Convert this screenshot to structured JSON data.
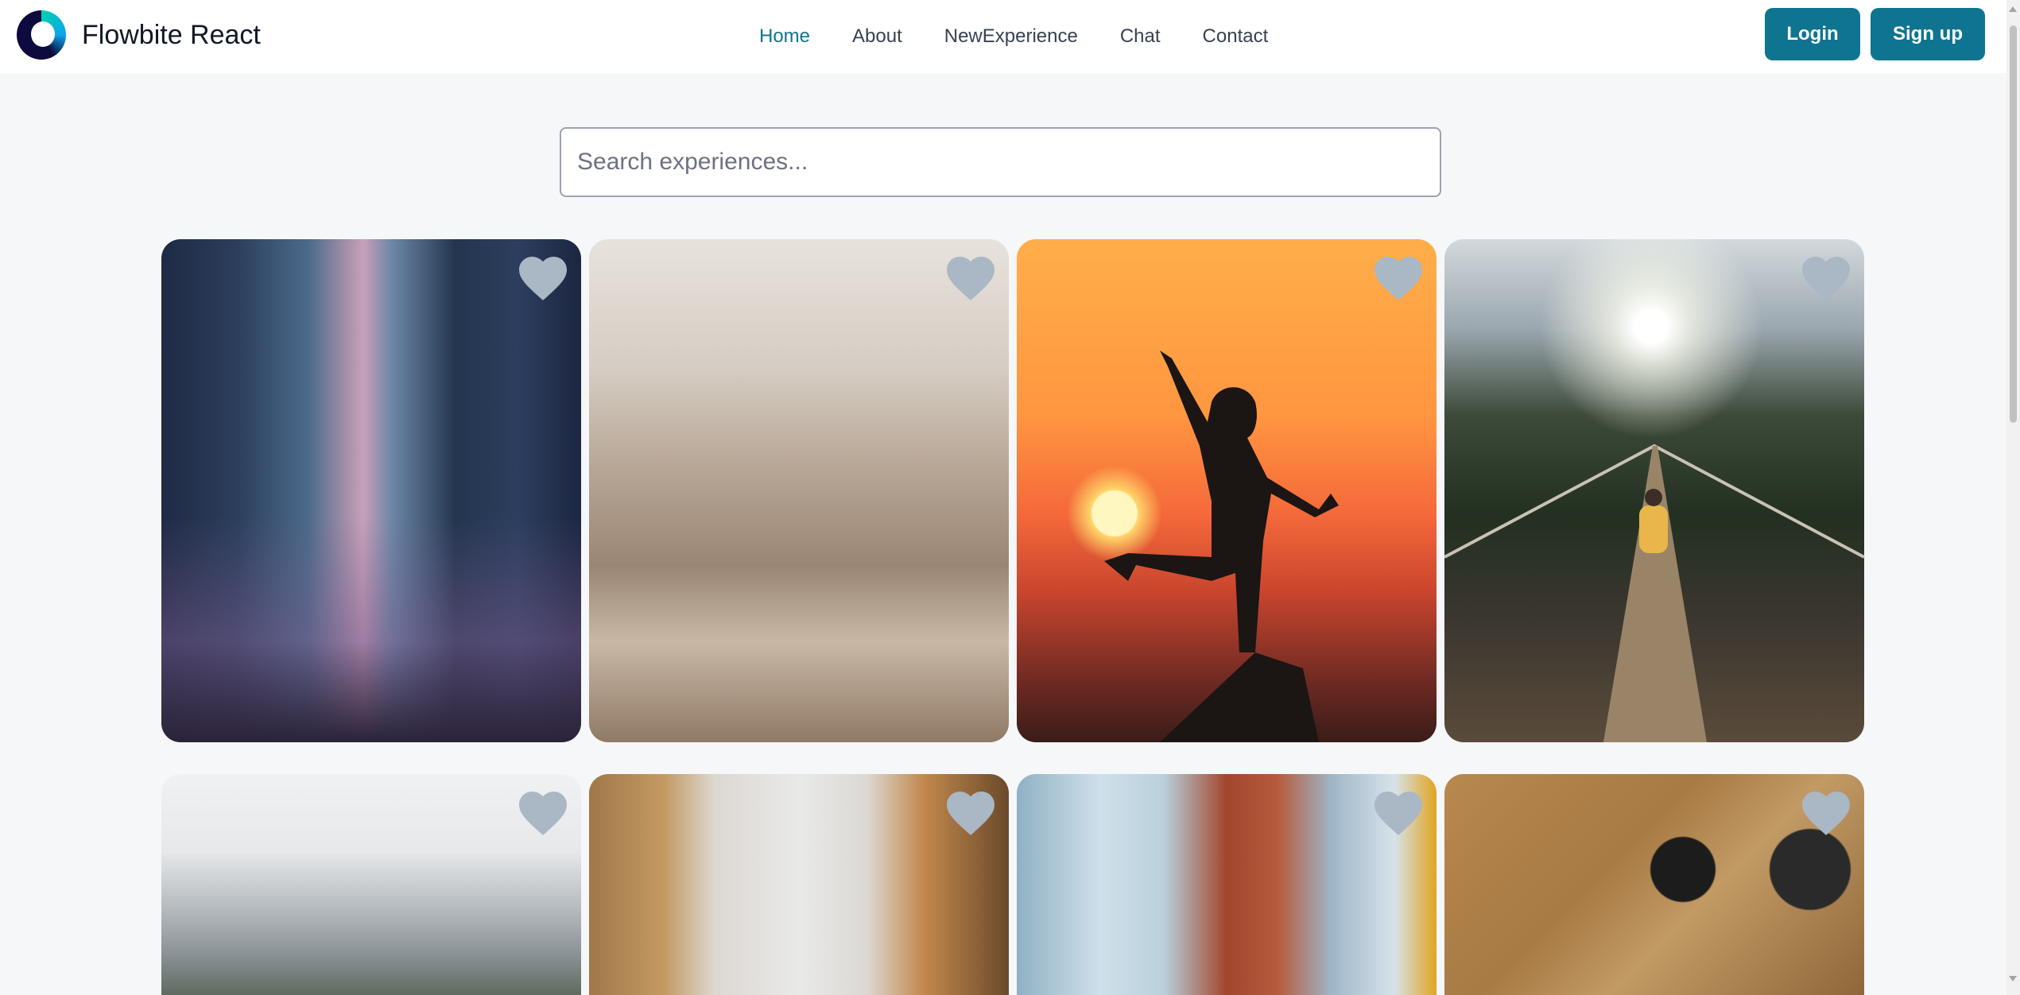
{
  "brand": {
    "name": "Flowbite React"
  },
  "nav": {
    "links": [
      {
        "label": "Home",
        "active": true
      },
      {
        "label": "About"
      },
      {
        "label": "NewExperience"
      },
      {
        "label": "Chat"
      },
      {
        "label": "Contact"
      }
    ]
  },
  "auth": {
    "login_label": "Login",
    "signup_label": "Sign up"
  },
  "search": {
    "placeholder": "Search experiences...",
    "value": ""
  },
  "cards": [
    {
      "image": "city street at dusk",
      "favorite_icon": "heart-icon"
    },
    {
      "image": "city skyline from above",
      "favorite_icon": "heart-icon"
    },
    {
      "image": "silhouette jumping at sunset",
      "favorite_icon": "heart-icon"
    },
    {
      "image": "hiker on suspension bridge",
      "favorite_icon": "heart-icon"
    },
    {
      "image": "rocky mountain range",
      "favorite_icon": "heart-icon"
    },
    {
      "image": "old buildings looking up",
      "favorite_icon": "heart-icon"
    },
    {
      "image": "toronto flatiron building",
      "favorite_icon": "heart-icon"
    },
    {
      "image": "vintage map with camera",
      "favorite_icon": "heart-icon"
    }
  ],
  "colors": {
    "accent": "#0e7490",
    "heart": "#aab7c4",
    "page_bg": "#f5f7f9"
  }
}
